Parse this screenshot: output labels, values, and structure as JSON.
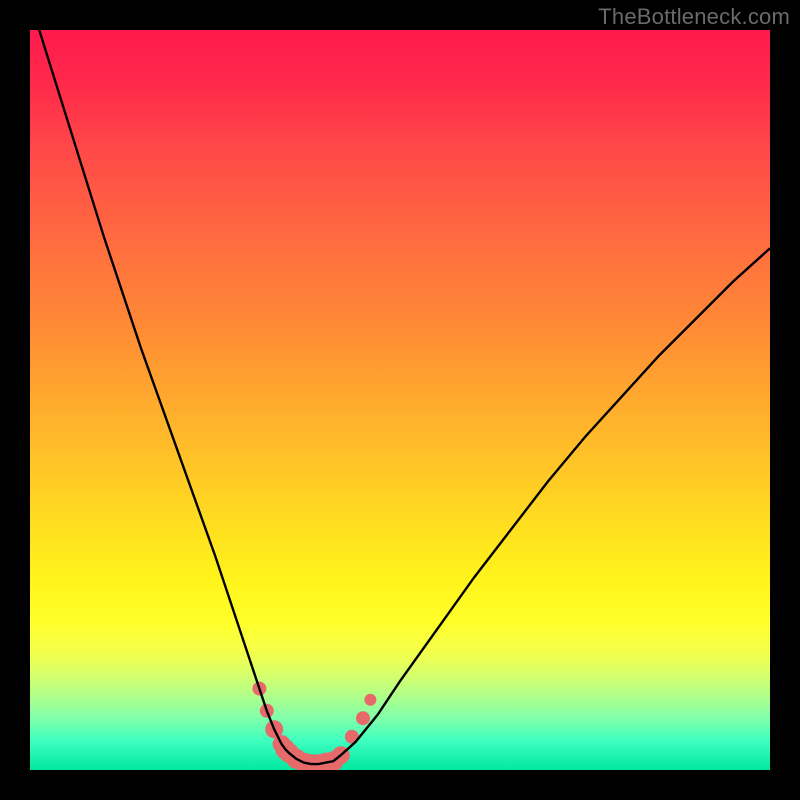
{
  "watermark": "TheBottleneck.com",
  "colors": {
    "background": "#000000",
    "curve": "#000000",
    "markers": "#e66a6a",
    "gradient_top": "#ff1a4d",
    "gradient_bottom": "#00e8a0"
  },
  "chart_data": {
    "type": "line",
    "title": "",
    "xlabel": "",
    "ylabel": "",
    "xlim": [
      0,
      100
    ],
    "ylim": [
      0,
      100
    ],
    "grid": false,
    "x": [
      0,
      5,
      10,
      15,
      20,
      25,
      27,
      29,
      31,
      32,
      33,
      34,
      34.5,
      35,
      36,
      37,
      38,
      39,
      40,
      41,
      42,
      44,
      47,
      50,
      55,
      60,
      65,
      70,
      75,
      80,
      85,
      90,
      95,
      100
    ],
    "y": [
      104,
      88,
      72,
      57,
      43,
      29,
      23,
      17,
      11,
      8,
      5.5,
      3.5,
      2.8,
      2.3,
      1.5,
      1.0,
      0.8,
      0.8,
      1.0,
      1.2,
      2.0,
      3.8,
      7.5,
      12,
      19,
      26,
      32.5,
      39,
      45,
      50.5,
      56,
      61,
      66,
      70.5
    ],
    "series": [
      {
        "name": "bottleneck-curve",
        "x": [
          0,
          5,
          10,
          15,
          20,
          25,
          27,
          29,
          31,
          32,
          33,
          34,
          34.5,
          35,
          36,
          37,
          38,
          39,
          40,
          41,
          42,
          44,
          47,
          50,
          55,
          60,
          65,
          70,
          75,
          80,
          85,
          90,
          95,
          100
        ],
        "y": [
          104,
          88,
          72,
          57,
          43,
          29,
          23,
          17,
          11,
          8,
          5.5,
          3.5,
          2.8,
          2.3,
          1.5,
          1.0,
          0.8,
          0.8,
          1.0,
          1.2,
          2.0,
          3.8,
          7.5,
          12,
          19,
          26,
          32.5,
          39,
          45,
          50.5,
          56,
          61,
          66,
          70.5
        ]
      }
    ],
    "markers": {
      "name": "highlighted-points",
      "color": "#e66a6a",
      "points": [
        {
          "x": 31.0,
          "y": 11.0,
          "r": 7
        },
        {
          "x": 32.0,
          "y": 8.0,
          "r": 7
        },
        {
          "x": 33.0,
          "y": 5.5,
          "r": 9
        },
        {
          "x": 34.0,
          "y": 3.5,
          "r": 9
        },
        {
          "x": 34.5,
          "y": 2.8,
          "r": 10
        },
        {
          "x": 35.0,
          "y": 2.3,
          "r": 10
        },
        {
          "x": 36.0,
          "y": 1.5,
          "r": 10
        },
        {
          "x": 37.0,
          "y": 1.0,
          "r": 10
        },
        {
          "x": 38.0,
          "y": 0.8,
          "r": 10
        },
        {
          "x": 39.0,
          "y": 0.8,
          "r": 10
        },
        {
          "x": 40.0,
          "y": 1.0,
          "r": 10
        },
        {
          "x": 41.0,
          "y": 1.2,
          "r": 10
        },
        {
          "x": 42.0,
          "y": 2.0,
          "r": 9
        },
        {
          "x": 43.5,
          "y": 4.5,
          "r": 7
        },
        {
          "x": 45.0,
          "y": 7.0,
          "r": 7
        },
        {
          "x": 46.0,
          "y": 9.5,
          "r": 6
        }
      ]
    }
  }
}
